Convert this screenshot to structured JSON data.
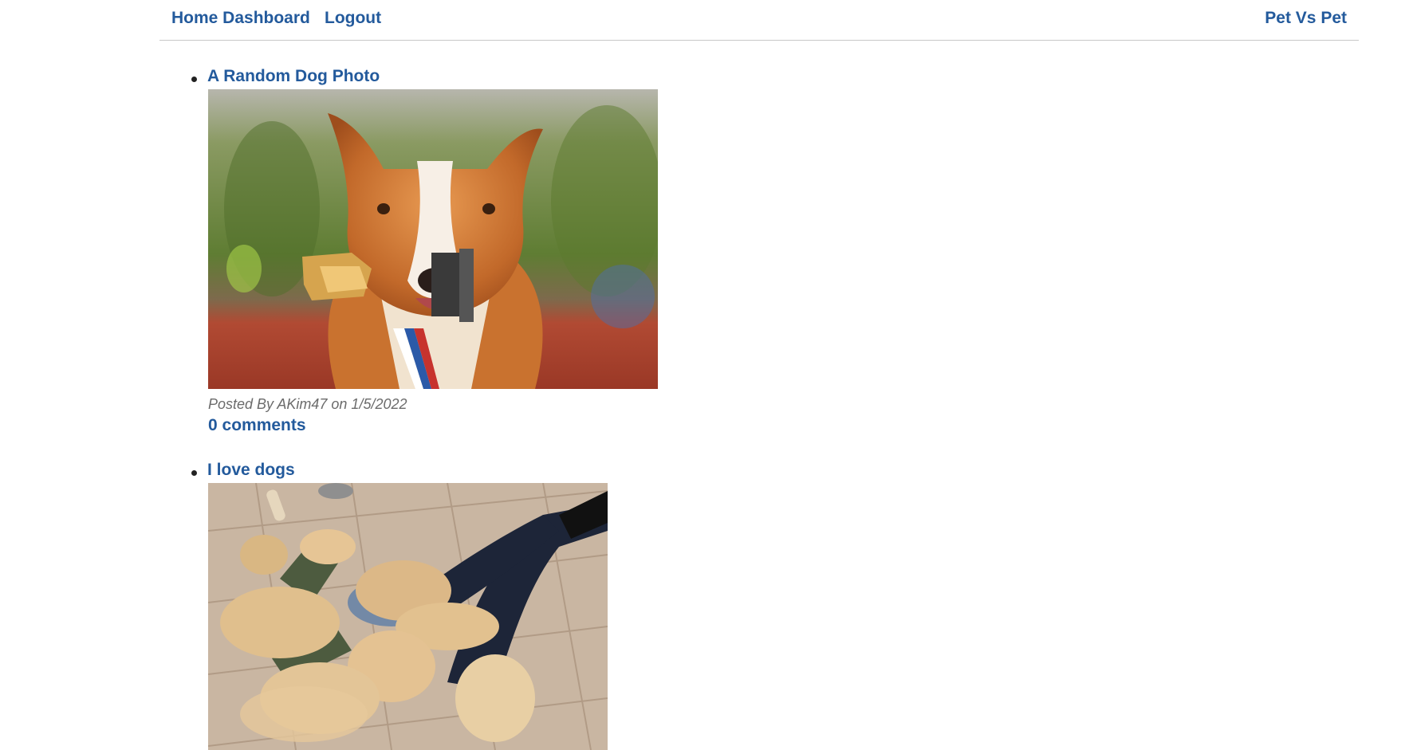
{
  "nav": {
    "home_label": "Home Dashboard",
    "logout_label": "Logout",
    "brand_label": "Pet Vs Pet"
  },
  "posts": [
    {
      "title": "A Random Dog Photo",
      "image_alt": "dog holding trophy photo",
      "meta": "Posted By AKim47 on 1/5/2022",
      "comments_label": "0 comments"
    },
    {
      "title": "I love dogs",
      "image_alt": "golden retriever puppies photo"
    }
  ],
  "colors": {
    "link": "#235a9c",
    "meta": "#6b6b6b",
    "divider": "#c8c8c8"
  }
}
